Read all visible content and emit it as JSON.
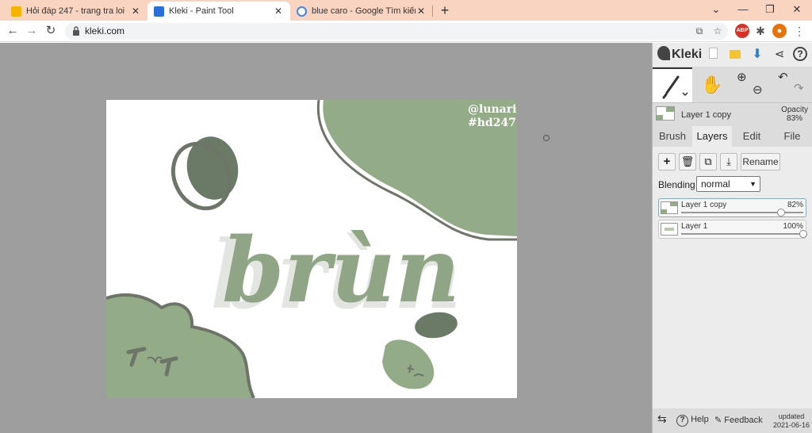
{
  "browser": {
    "tabs": [
      {
        "title": "Hỏi đáp 247 - trang tra loi",
        "favicon": "hoidap-favicon-icon",
        "color": "#f5b400"
      },
      {
        "title": "Kleki - Paint Tool",
        "favicon": "kleki-favicon-icon",
        "color": "#2a6fdb"
      },
      {
        "title": "blue caro - Google Tìm kiếm",
        "favicon": "google-favicon-icon",
        "color": "#4285f4"
      }
    ],
    "close_glyph": "✕",
    "new_tab_glyph": "+",
    "url": "kleki.com"
  },
  "canvas": {
    "watermark_line1": "@lunarie",
    "watermark_line2": "#hd247",
    "artwork_text": "brùn",
    "colors": {
      "sage": "#94ab88",
      "dark_sage": "#6b7a66",
      "shadow": "#e3e6e0",
      "outline": "#6d7568"
    }
  },
  "panel": {
    "app_name": "Kleki",
    "layer": {
      "name": "Layer 1 copy",
      "opacity_label": "Opacity",
      "opacity_value": "83%"
    },
    "tabs": [
      "Brush",
      "Layers",
      "Edit",
      "File"
    ],
    "active_tab": "Layers",
    "buttons": {
      "rename": "Rename"
    },
    "blending_label": "Blending",
    "blending_value": "normal",
    "layers": [
      {
        "name": "Layer 1 copy",
        "opacity": "82%",
        "value": 0.82
      },
      {
        "name": "Layer 1",
        "opacity": "100%",
        "value": 1.0
      }
    ],
    "footer": {
      "help": "Help",
      "feedback": "Feedback",
      "updated_label": "updated",
      "updated_date": "2021-06-16"
    }
  }
}
